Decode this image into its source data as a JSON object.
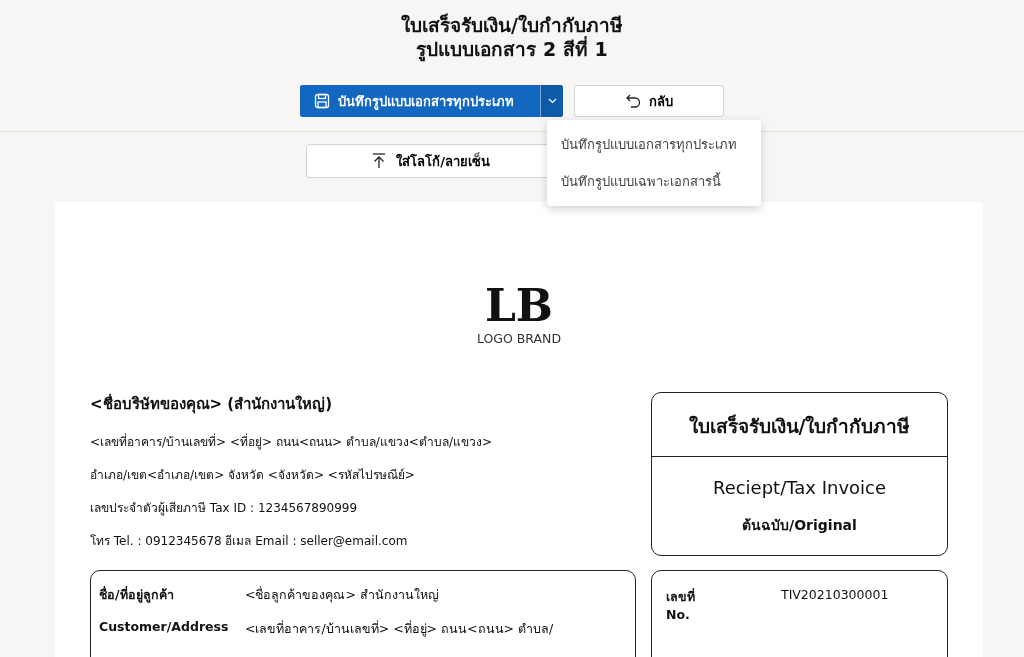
{
  "title": {
    "line_1": "ใบเสร็จรับเงิน/ใบกำกับภาษี",
    "line_2": "รูปแบบเอกสาร 2 สีที่ 1"
  },
  "toolbar": {
    "save_button": "บันทึกรูปแบบเอกสารทุกประเภท",
    "back_button": "กลับ",
    "upload_button": "ใส่โลโก้/ลายเซ็น"
  },
  "save_menu": {
    "expanded": true,
    "items": [
      {
        "label": "บันทึกรูปแบบเอกสารทุกประเภท"
      },
      {
        "label": "บันทึกรูปแบบเฉพาะเอกสารนี้"
      }
    ]
  },
  "document": {
    "logo": {
      "mark": "LB",
      "name": "LOGO BRAND"
    },
    "company": {
      "name": "<ชื่อบริษัทของคุณ> (สำนักงานใหญ่)",
      "lines": [
        "<เลขที่อาคาร/บ้านเลขที่> <ที่อยู่> ถนน<ถนน> ตำบล/แขวง<ตำบล/แขวง>",
        "อำเภอ/เขต<อำเภอ/เขต> จังหวัด <จังหวัด> <รหัสไปรษณีย์>",
        "เลขประจำตัวผู้เสียภาษี Tax ID : 1234567890999",
        "โทร Tel. : 0912345678  อีเมล Email : seller@email.com"
      ]
    },
    "doc_type": {
      "title_th": "ใบเสร็จรับเงิน/ใบกำกับภาษี",
      "title_en": "Reciept/Tax Invoice",
      "copy": "ต้นฉบับ/Original"
    },
    "customer": [
      {
        "label": "ชื่อ/ที่อยู่ลูกค้า",
        "value": "<ชื่อลูกค้าของคุณ> สำนักงานใหญ่"
      },
      {
        "label": "Customer/Address",
        "value": "<เลขที่อาคาร/บ้านเลขที่> <ที่อยู่> ถนน<ถนน> ตำบล/"
      }
    ],
    "info": [
      {
        "label": "เลขที่",
        "label_en": "No.",
        "value": "TIV20210300001"
      }
    ]
  }
}
